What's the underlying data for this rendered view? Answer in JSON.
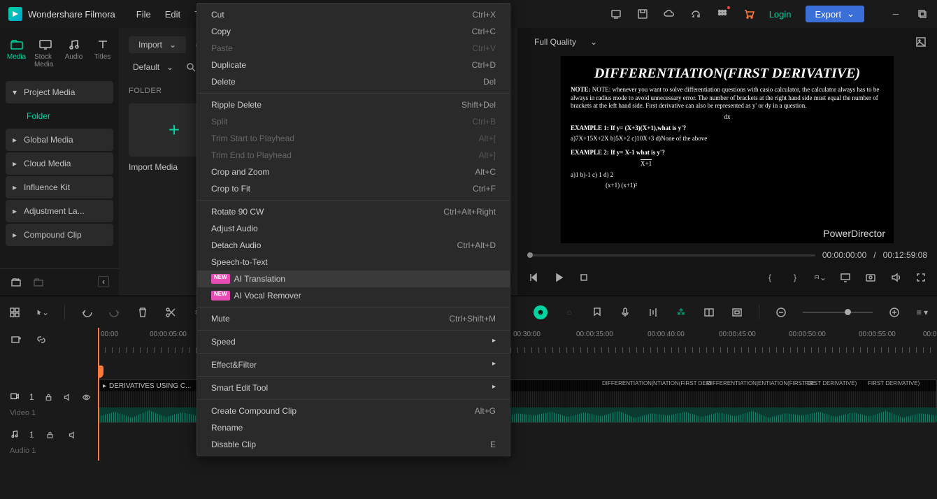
{
  "app": {
    "title": "Wondershare Filmora"
  },
  "menu": {
    "file": "File",
    "edit": "Edit",
    "tools": "To"
  },
  "titlebar": {
    "login": "Login",
    "export": "Export"
  },
  "tabs": {
    "media": "Media",
    "stock": "Stock Media",
    "audio": "Audio",
    "titles": "Titles"
  },
  "tree": {
    "project": "Project Media",
    "folder": "Folder",
    "global": "Global Media",
    "cloud": "Cloud Media",
    "influence": "Influence Kit",
    "adjust": "Adjustment La...",
    "compound": "Compound Clip"
  },
  "media": {
    "import": "Import",
    "default": "Default",
    "folder_hdr": "FOLDER",
    "import_media": "Import Media"
  },
  "preview": {
    "quality": "Full Quality",
    "time_cur": "00:00:00:00",
    "time_sep": "/",
    "time_total": "00:12:59:08",
    "frame": {
      "title": "DIFFERENTIATION(FIRST DERIVATIVE)",
      "note": "NOTE: whenever you want to solve differentiation questions with casio calculator, the calculator always has to be always in radius mode to avoid unnecessary error. The number of brackets at the right hand side must equal the number of brackets at the left hand side. First derivative can also be represented as y' or dy in a question.",
      "dx": "dx",
      "ex1": "EXAMPLE 1: If y= (X+3)(X+1),what is y'?",
      "ex1o": "a)7X+15X+2X b)5X+2 c)10X+3 d)None of the above",
      "ex2": "EXAMPLE 2: If y= X-1 what is y'?",
      "ex2d": "X+1",
      "ex2o": "a)1 b)-1 c)  1   d)  2",
      "ex2o2": "(x+1) (x+1)²",
      "pd": "PowerDirector"
    }
  },
  "ruler": [
    "00:00",
    "00:00:05:00",
    "00:30:00",
    "00:00:35:00",
    "00:00:40:00",
    "00:00:45:00",
    "00:00:50:00",
    "00:00:55:00",
    "00:0"
  ],
  "tracks": {
    "v1_num": "1",
    "v1": "Video 1",
    "a1_num": "1",
    "a1": "Audio 1"
  },
  "clip": {
    "title": "DERIVATIVES USING C...",
    "segs": [
      "DIFFERENTIATION|NTIATION(FIRST DERI",
      "DIFFERENTIATION|ENTIATION(FIRST DE",
      "FIRST DERIVATIVE)",
      "FIRST DERIVATIVE)"
    ]
  },
  "ctx": {
    "badge": "NEW",
    "items": [
      {
        "l": "Cut",
        "k": "Ctrl+X"
      },
      {
        "l": "Copy",
        "k": "Ctrl+C"
      },
      {
        "l": "Paste",
        "k": "Ctrl+V",
        "d": true
      },
      {
        "l": "Duplicate",
        "k": "Ctrl+D"
      },
      {
        "l": "Delete",
        "k": "Del"
      },
      {
        "l": "Ripple Delete",
        "k": "Shift+Del"
      },
      {
        "l": "Split",
        "k": "Ctrl+B",
        "d": true
      },
      {
        "l": "Trim Start to Playhead",
        "k": "Alt+[",
        "d": true
      },
      {
        "l": "Trim End to Playhead",
        "k": "Alt+]",
        "d": true
      },
      {
        "l": "Crop and Zoom",
        "k": "Alt+C"
      },
      {
        "l": "Crop to Fit",
        "k": "Ctrl+F"
      },
      {
        "l": "Rotate 90 CW",
        "k": "Ctrl+Alt+Right"
      },
      {
        "l": "Adjust Audio"
      },
      {
        "l": "Detach Audio",
        "k": "Ctrl+Alt+D"
      },
      {
        "l": "Speech-to-Text"
      },
      {
        "l": "AI Translation",
        "new": true,
        "hov": true
      },
      {
        "l": "AI Vocal Remover",
        "new": true
      },
      {
        "l": "Mute",
        "k": "Ctrl+Shift+M"
      },
      {
        "l": "Speed",
        "sub": true
      },
      {
        "l": "Effect&Filter",
        "sub": true
      },
      {
        "l": "Smart Edit Tool",
        "sub": true
      },
      {
        "l": "Create Compound Clip",
        "k": "Alt+G"
      },
      {
        "l": "Rename"
      },
      {
        "l": "Disable Clip",
        "k": "E"
      }
    ]
  }
}
